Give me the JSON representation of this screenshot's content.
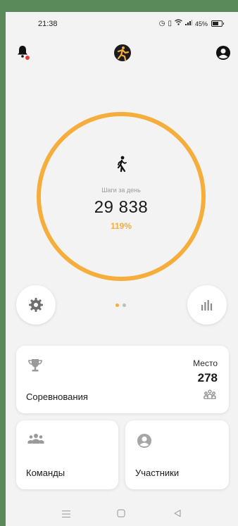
{
  "status_bar": {
    "time": "21:38",
    "battery": "45%"
  },
  "colors": {
    "accent": "#f5ad3c",
    "background": "#f3f3f3",
    "notification_dot": "#e53935"
  },
  "header": {
    "icons": [
      "bell-icon",
      "app-logo",
      "profile-icon"
    ]
  },
  "steps": {
    "label": "Шаги за день",
    "value": "29 838",
    "percent": "119%"
  },
  "pager": {
    "pages": 2,
    "active": 0
  },
  "cards": {
    "competitions": {
      "title": "Соревнования",
      "rank_label": "Место",
      "rank_value": "278"
    },
    "teams": {
      "title": "Команды"
    },
    "participants": {
      "title": "Участники"
    }
  },
  "navbar": {
    "icons": [
      "menu-icon",
      "home-icon",
      "back-icon"
    ]
  }
}
